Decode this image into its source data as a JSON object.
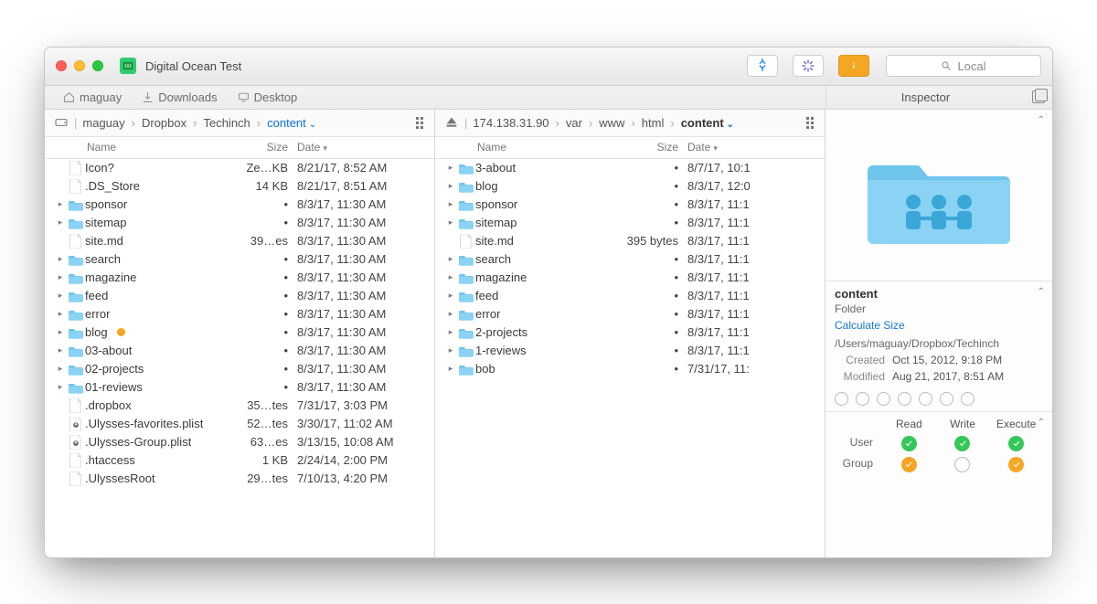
{
  "window": {
    "title": "Digital Ocean Test"
  },
  "toolbar": {
    "search_placeholder": "Local",
    "sync_icon": "sync-icon",
    "spinner_icon": "activity-icon",
    "info_icon": "info-icon"
  },
  "favorites": {
    "left": [
      {
        "icon": "home",
        "label": "maguay"
      },
      {
        "icon": "download",
        "label": "Downloads"
      },
      {
        "icon": "desktop",
        "label": "Desktop"
      }
    ],
    "inspector_label": "Inspector"
  },
  "left_pane": {
    "breadcrumbs": [
      "maguay",
      "Dropbox",
      "Techinch",
      "content"
    ],
    "current_has_dropdown": true,
    "columns": {
      "name": "Name",
      "size": "Size",
      "date": "Date"
    },
    "rows": [
      {
        "kind": "file",
        "name": "Icon?",
        "size": "Ze…KB",
        "date": "8/21/17, 8:52 AM",
        "expandable": false
      },
      {
        "kind": "file",
        "name": ".DS_Store",
        "size": "14 KB",
        "date": "8/21/17, 8:51 AM",
        "expandable": false
      },
      {
        "kind": "folder",
        "name": "sponsor",
        "size": "•",
        "date": "8/3/17, 11:30 AM",
        "expandable": true
      },
      {
        "kind": "folder",
        "name": "sitemap",
        "size": "•",
        "date": "8/3/17, 11:30 AM",
        "expandable": true
      },
      {
        "kind": "file",
        "name": "site.md",
        "size": "39…es",
        "date": "8/3/17, 11:30 AM",
        "expandable": false
      },
      {
        "kind": "folder",
        "name": "search",
        "size": "•",
        "date": "8/3/17, 11:30 AM",
        "expandable": true
      },
      {
        "kind": "folder",
        "name": "magazine",
        "size": "•",
        "date": "8/3/17, 11:30 AM",
        "expandable": true
      },
      {
        "kind": "folder",
        "name": "feed",
        "size": "•",
        "date": "8/3/17, 11:30 AM",
        "expandable": true
      },
      {
        "kind": "folder",
        "name": "error",
        "size": "•",
        "date": "8/3/17, 11:30 AM",
        "expandable": true
      },
      {
        "kind": "folder",
        "name": "blog",
        "size": "•",
        "date": "8/3/17, 11:30 AM",
        "expandable": true,
        "badge": "orange"
      },
      {
        "kind": "folder",
        "name": "03-about",
        "size": "•",
        "date": "8/3/17, 11:30 AM",
        "expandable": true
      },
      {
        "kind": "folder",
        "name": "02-projects",
        "size": "•",
        "date": "8/3/17, 11:30 AM",
        "expandable": true
      },
      {
        "kind": "folder",
        "name": "01-reviews",
        "size": "•",
        "date": "8/3/17, 11:30 AM",
        "expandable": true
      },
      {
        "kind": "file",
        "name": ".dropbox",
        "size": "35…tes",
        "date": "7/31/17, 3:03 PM",
        "expandable": false
      },
      {
        "kind": "plist",
        "name": ".Ulysses-favorites.plist",
        "size": "52…tes",
        "date": "3/30/17, 11:02 AM",
        "expandable": false
      },
      {
        "kind": "plist",
        "name": ".Ulysses-Group.plist",
        "size": "63…es",
        "date": "3/13/15, 10:08 AM",
        "expandable": false
      },
      {
        "kind": "file",
        "name": ".htaccess",
        "size": "1 KB",
        "date": "2/24/14, 2:00 PM",
        "expandable": false
      },
      {
        "kind": "file",
        "name": ".UlyssesRoot",
        "size": "29…tes",
        "date": "7/10/13, 4:20 PM",
        "expandable": false
      }
    ]
  },
  "right_pane": {
    "breadcrumbs": [
      "174.138.31.90",
      "var",
      "www",
      "html",
      "content"
    ],
    "current_has_dropdown": true,
    "columns": {
      "name": "Name",
      "size": "Size",
      "date": "Date"
    },
    "rows": [
      {
        "kind": "folder",
        "name": "3-about",
        "size": "•",
        "date": "8/7/17, 10:1",
        "expandable": true
      },
      {
        "kind": "folder",
        "name": "blog",
        "size": "•",
        "date": "8/3/17, 12:0",
        "expandable": true
      },
      {
        "kind": "folder",
        "name": "sponsor",
        "size": "•",
        "date": "8/3/17, 11:1",
        "expandable": true
      },
      {
        "kind": "folder",
        "name": "sitemap",
        "size": "•",
        "date": "8/3/17, 11:1",
        "expandable": true
      },
      {
        "kind": "file",
        "name": "site.md",
        "size": "395 bytes",
        "date": "8/3/17, 11:1",
        "expandable": false
      },
      {
        "kind": "folder",
        "name": "search",
        "size": "•",
        "date": "8/3/17, 11:1",
        "expandable": true
      },
      {
        "kind": "folder",
        "name": "magazine",
        "size": "•",
        "date": "8/3/17, 11:1",
        "expandable": true
      },
      {
        "kind": "folder",
        "name": "feed",
        "size": "•",
        "date": "8/3/17, 11:1",
        "expandable": true
      },
      {
        "kind": "folder",
        "name": "error",
        "size": "•",
        "date": "8/3/17, 11:1",
        "expandable": true
      },
      {
        "kind": "folder",
        "name": "2-projects",
        "size": "•",
        "date": "8/3/17, 11:1",
        "expandable": true
      },
      {
        "kind": "folder",
        "name": "1-reviews",
        "size": "•",
        "date": "8/3/17, 11:1",
        "expandable": true
      },
      {
        "kind": "folder",
        "name": "bob",
        "size": "•",
        "date": "7/31/17, 11:",
        "expandable": true
      }
    ]
  },
  "inspector": {
    "name": "content",
    "kind": "Folder",
    "calc_size_label": "Calculate Size",
    "path": "/Users/maguay/Dropbox/Techinch",
    "created_label": "Created",
    "created": "Oct 15, 2012, 9:18 PM",
    "modified_label": "Modified",
    "modified": "Aug 21, 2017, 8:51 AM",
    "perm_headers": {
      "read": "Read",
      "write": "Write",
      "execute": "Execute"
    },
    "perm_row_labels": {
      "user": "User",
      "group": "Group"
    },
    "permissions": {
      "user": {
        "read": "green",
        "write": "green",
        "execute": "green"
      },
      "group": {
        "read": "orange",
        "write": "empty",
        "execute": "orange"
      }
    }
  }
}
